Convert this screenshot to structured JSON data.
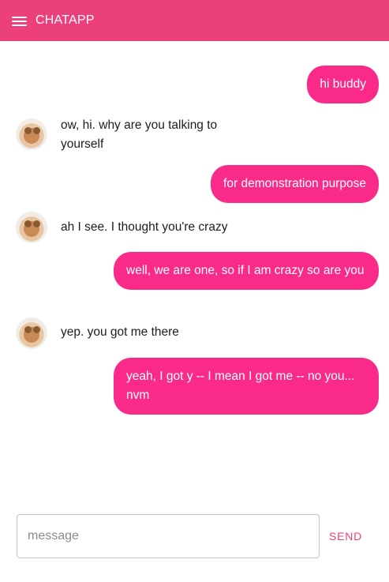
{
  "app": {
    "title": "CHATAPP"
  },
  "messages": [
    {
      "from": "me",
      "text": "hi buddy"
    },
    {
      "from": "bot",
      "text": "ow, hi. why are you talking to yourself"
    },
    {
      "from": "me",
      "text": "for demonstration purpose"
    },
    {
      "from": "bot",
      "text": "ah I see. I thought you're crazy"
    },
    {
      "from": "me",
      "text": "well, we are one, so if I am crazy so are you"
    },
    {
      "from": "bot",
      "text": "yep. you got me there"
    },
    {
      "from": "me",
      "text": "yeah, I got y -- I mean I got me -- no you... nvm"
    }
  ],
  "composer": {
    "placeholder": "message",
    "value": "",
    "send_label": "SEND"
  },
  "colors": {
    "appbar": "#ec407a",
    "bubble": "#fa2b88",
    "send": "#ec407a"
  }
}
